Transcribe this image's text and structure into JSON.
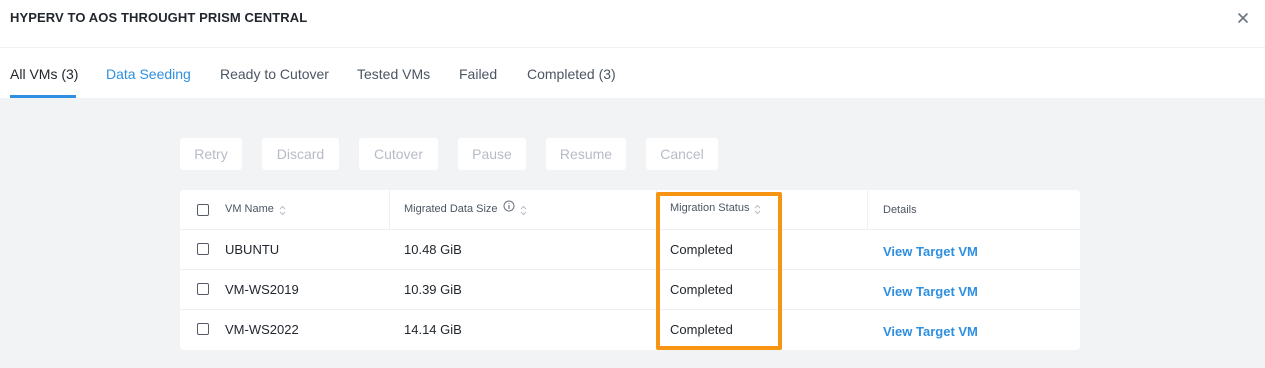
{
  "header": {
    "title": "HYPERV TO AOS THROUGHT PRISM CENTRAL"
  },
  "tabs": [
    {
      "label": "All VMs (3)"
    },
    {
      "label": "Data Seeding"
    },
    {
      "label": "Ready to Cutover"
    },
    {
      "label": "Tested VMs"
    },
    {
      "label": "Failed"
    },
    {
      "label": "Completed (3)"
    }
  ],
  "actions": {
    "retry": "Retry",
    "discard": "Discard",
    "cutover": "Cutover",
    "pause": "Pause",
    "resume": "Resume",
    "cancel": "Cancel"
  },
  "table": {
    "columns": {
      "vm_name": "VM Name",
      "migrated_data_size": "Migrated Data Size",
      "migration_status": "Migration Status",
      "details": "Details"
    },
    "rows": [
      {
        "vm_name": "UBUNTU",
        "size": "10.48 GiB",
        "status": "Completed",
        "details": "View Target VM"
      },
      {
        "vm_name": "VM-WS2019",
        "size": "10.39 GiB",
        "status": "Completed",
        "details": "View Target VM"
      },
      {
        "vm_name": "VM-WS2022",
        "size": "14.14 GiB",
        "status": "Completed",
        "details": "View Target VM"
      }
    ]
  },
  "colors": {
    "accent": "#2f8fe0",
    "highlight": "#f79412"
  }
}
